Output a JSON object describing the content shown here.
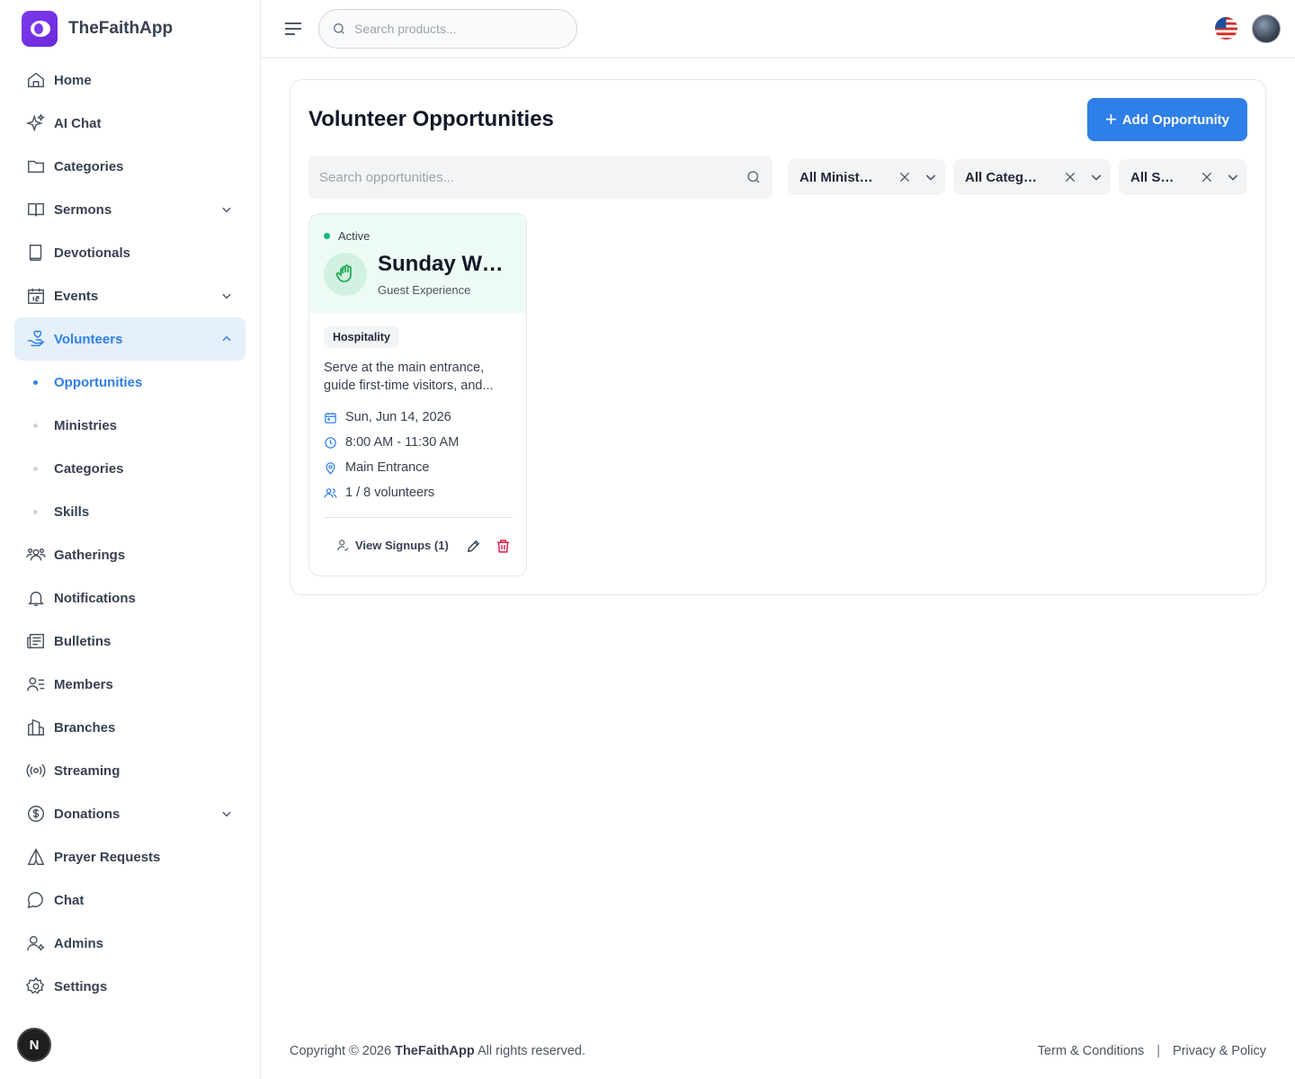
{
  "app": {
    "name": "TheFaithApp"
  },
  "search": {
    "placeholder": "Search products..."
  },
  "sidebar": {
    "items": [
      {
        "label": "Home",
        "icon": "home-icon"
      },
      {
        "label": "AI Chat",
        "icon": "sparkles-icon"
      },
      {
        "label": "Categories",
        "icon": "folder-icon"
      },
      {
        "label": "Sermons",
        "icon": "book-open-icon"
      },
      {
        "label": "Devotionals",
        "icon": "book-icon"
      },
      {
        "label": "Events",
        "icon": "calendar-icon"
      },
      {
        "label": "Volunteers",
        "icon": "hand-heart-icon"
      },
      {
        "label": "Gatherings",
        "icon": "users-group-icon"
      },
      {
        "label": "Notifications",
        "icon": "bell-icon"
      },
      {
        "label": "Bulletins",
        "icon": "newspaper-icon"
      },
      {
        "label": "Members",
        "icon": "user-list-icon"
      },
      {
        "label": "Branches",
        "icon": "building-icon"
      },
      {
        "label": "Streaming",
        "icon": "broadcast-icon"
      },
      {
        "label": "Donations",
        "icon": "dollar-circle-icon"
      },
      {
        "label": "Prayer Requests",
        "icon": "praying-hands-icon"
      },
      {
        "label": "Chat",
        "icon": "chat-bubble-icon"
      },
      {
        "label": "Admins",
        "icon": "user-gear-icon"
      },
      {
        "label": "Settings",
        "icon": "gear-icon"
      }
    ],
    "volunteer_sub": [
      {
        "label": "Opportunities"
      },
      {
        "label": "Ministries"
      },
      {
        "label": "Categories"
      },
      {
        "label": "Skills"
      }
    ],
    "badge": "N"
  },
  "main": {
    "title": "Volunteer Opportunities",
    "add_button": "Add Opportunity",
    "search_placeholder": "Search opportunities...",
    "filters": [
      "All Ministries",
      "All Categories",
      "All Statuses"
    ]
  },
  "opportunity": {
    "status": "Active",
    "title": "Sunday Welcome Team",
    "subtitle": "Guest Experience",
    "tag": "Hospitality",
    "description": "Serve at the main entrance, guide first-time visitors, and...",
    "date": "Sun, Jun 14, 2026",
    "time": "8:00 AM - 11:30 AM",
    "location": "Main Entrance",
    "volunteers": "1 / 8 volunteers",
    "signups_label": "View Signups (1)"
  },
  "footer": {
    "copyright_prefix": "Copyright © 2026",
    "brand": "TheFaithApp",
    "copyright_suffix": "All rights reserved.",
    "terms": "Term & Conditions",
    "privacy": "Privacy & Policy"
  },
  "colors": {
    "accent": "#2f7fe8",
    "brand": "#7c3aed",
    "active_bg": "#e6f0fb",
    "success": "#10b981",
    "danger": "#e11d48"
  }
}
